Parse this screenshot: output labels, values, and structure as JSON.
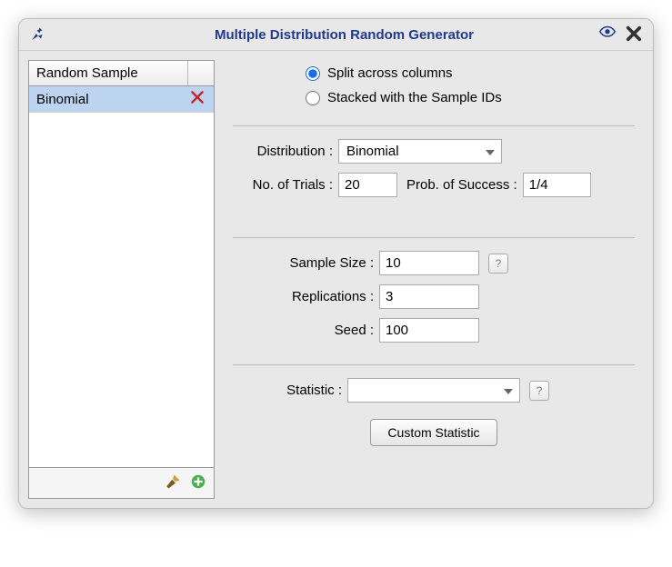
{
  "titlebar": {
    "title": "Multiple Distribution Random Generator"
  },
  "sidebar": {
    "header_col1": "Random Sample",
    "rows": [
      {
        "label": "Binomial"
      }
    ]
  },
  "layout": {
    "radio_split": "Split across columns",
    "radio_stacked": "Stacked with the Sample IDs",
    "selected": "split"
  },
  "distribution": {
    "label": "Distribution :",
    "value": "Binomial",
    "trials_label": "No. of Trials :",
    "trials_value": "20",
    "prob_label": "Prob. of Success :",
    "prob_value": "1/4"
  },
  "sampling": {
    "size_label": "Sample Size :",
    "size_value": "10",
    "reps_label": "Replications :",
    "reps_value": "3",
    "seed_label": "Seed :",
    "seed_value": "100"
  },
  "statistic": {
    "label": "Statistic :",
    "value": "",
    "custom_label": "Custom Statistic"
  }
}
